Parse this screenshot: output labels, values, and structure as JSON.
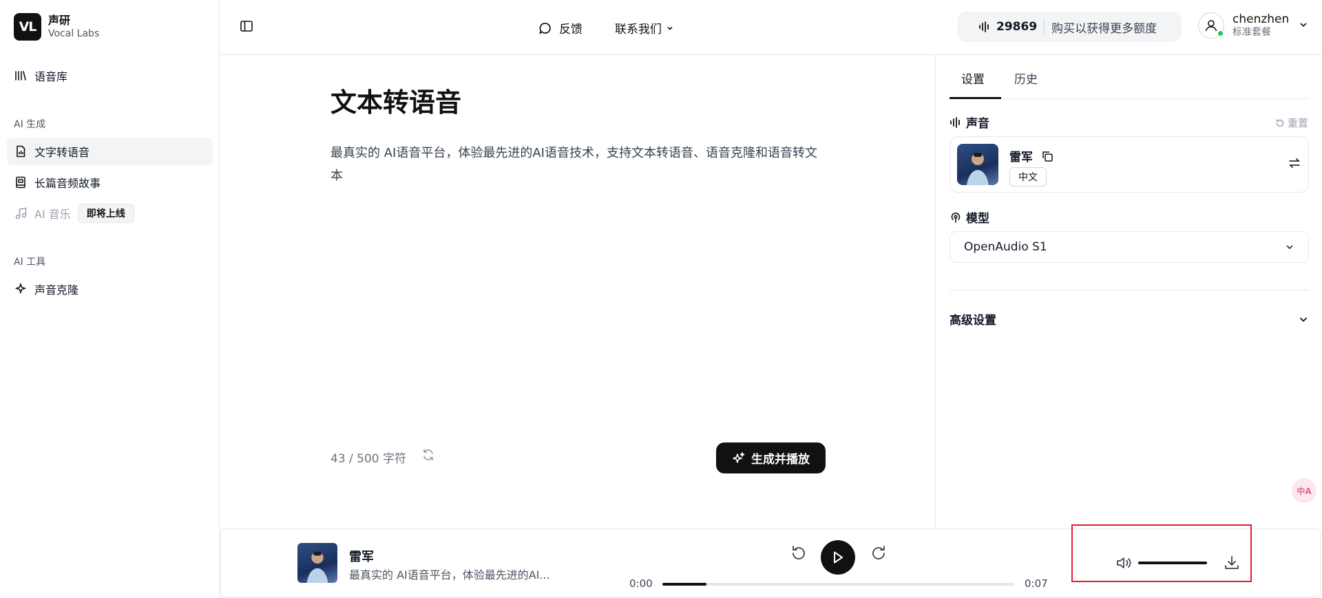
{
  "brand": {
    "logo": "VL",
    "name": "声研",
    "subtitle": "Vocal Labs"
  },
  "sidebar": {
    "library": "语音库",
    "group_ai_gen": "AI 生成",
    "tts": "文字转语音",
    "story": "长篇音频故事",
    "music": "AI 音乐",
    "music_badge": "即将上线",
    "group_ai_tools": "AI 工具",
    "clone": "声音克隆"
  },
  "header": {
    "feedback": "反馈",
    "contact": "联系我们",
    "credits": "29869",
    "buy": "购买以获得更多额度",
    "username": "chenzhen",
    "plan": "标准套餐"
  },
  "main": {
    "title": "文本转语音",
    "text": "最真实的 AI语音平台，体验最先进的AI语音技术，支持文本转语音、语音克隆和语音转文本",
    "char_count": "43 / 500 字符",
    "generate": "生成并播放"
  },
  "panel": {
    "tab_settings": "设置",
    "tab_history": "历史",
    "voice_heading": "声音",
    "reset": "重置",
    "voice_name": "雷军",
    "voice_lang": "中文",
    "model_heading": "模型",
    "model_value": "OpenAudio S1",
    "advanced": "高级设置"
  },
  "translate_fab": "中A",
  "player": {
    "name": "雷军",
    "desc": "最真实的 AI语音平台，体验最先进的AI...",
    "time_current": "0:00",
    "time_total": "0:07",
    "progress": 0.125,
    "volume": 1.0
  },
  "colors": {
    "accent": "#111111",
    "highlight": "#e11d2e",
    "online": "#22c55e"
  }
}
